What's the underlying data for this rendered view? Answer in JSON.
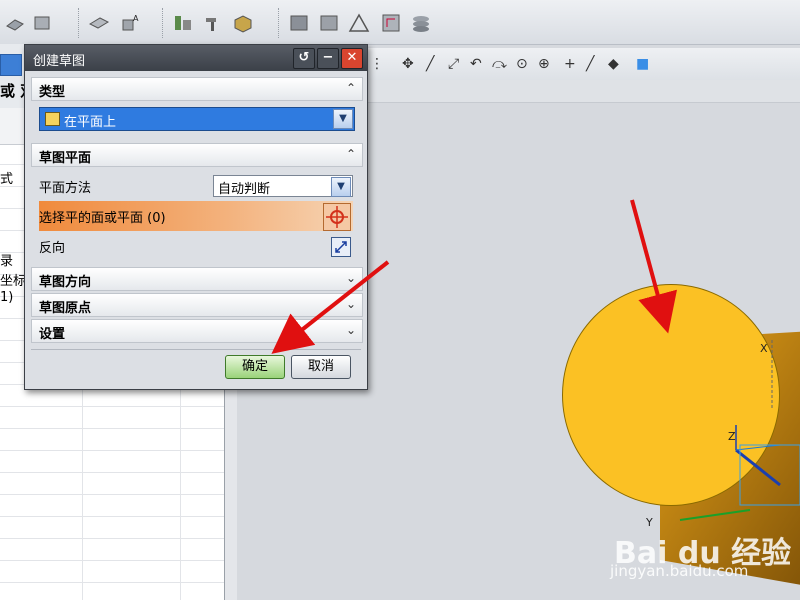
{
  "dialog": {
    "title": "创建草图",
    "sections": {
      "type": "类型",
      "sketch_plane": "草图平面",
      "sketch_orientation": "草图方向",
      "sketch_origin": "草图原点",
      "settings": "设置"
    },
    "type_value": "在平面上",
    "plane_method_label": "平面方法",
    "plane_method_value": "自动判断",
    "select_face_label": "选择平的面或平面 (0)",
    "reverse_label": "反向",
    "ok_label": "确定",
    "cancel_label": "取消",
    "title_buttons": {
      "back": "↺",
      "minimize": "−",
      "close": "✕"
    }
  },
  "left_panel": {
    "title_fragment": "或 双",
    "row_texts": [
      "式",
      "录",
      "坐标系",
      "1)"
    ]
  },
  "axes": {
    "y": "Y",
    "z": "Z",
    "x": "X"
  },
  "watermark": {
    "logo": "Bai du 经验",
    "url": "jingyan.baidu.com"
  },
  "colors": {
    "cylinder": "#fbc124",
    "highlight": "#f08a3c",
    "arrow": "#e01010"
  }
}
